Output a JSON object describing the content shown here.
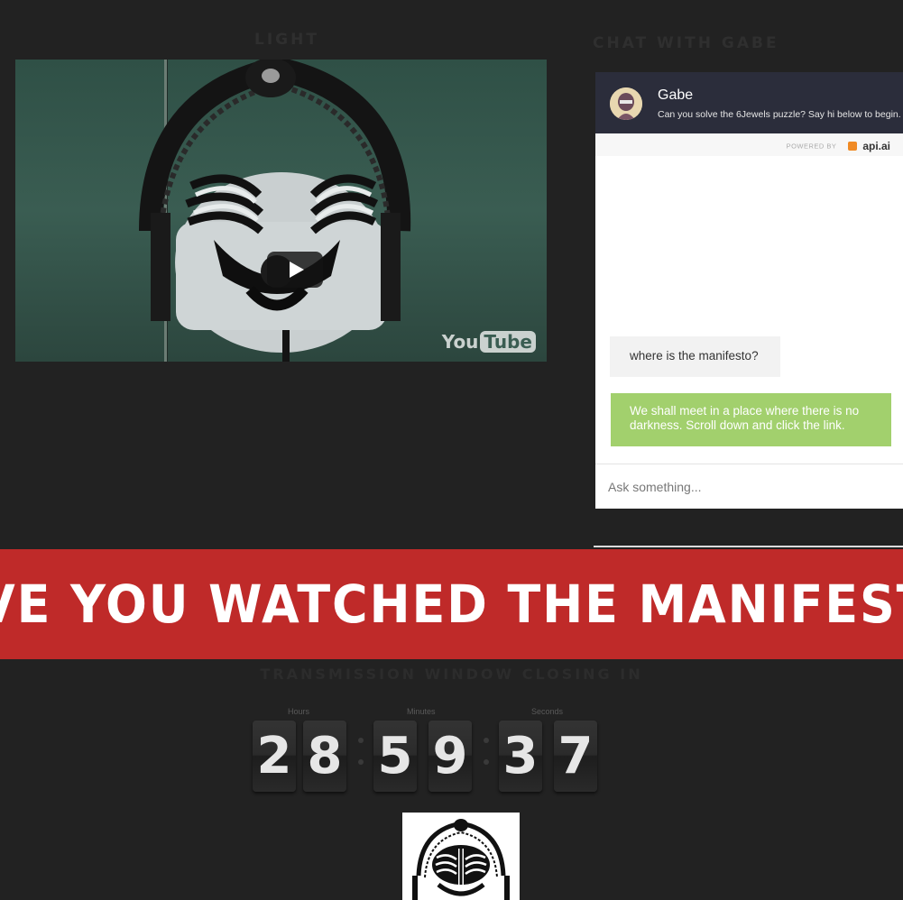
{
  "sections": {
    "light_title": "LIGHT",
    "chat_title": "CHAT WITH GABE"
  },
  "video": {
    "logo_you": "You",
    "logo_tube": "Tube"
  },
  "chat": {
    "agent_name": "Gabe",
    "agent_subtitle": "Can you solve the 6Jewels puzzle? Say hi below to begin.",
    "powered_by": "POWERED BY",
    "provider": "api.ai",
    "messages": [
      {
        "from": "user",
        "text": "where is the manifesto?"
      },
      {
        "from": "bot",
        "text": "We shall meet in a place where there is no darkness. Scroll down and click the link."
      }
    ],
    "input_placeholder": "Ask something...",
    "colors": {
      "header": "#2b2d3b",
      "bot_bubble": "#a2d06d",
      "user_bubble": "#f2f2f2"
    }
  },
  "banner": {
    "text": "HAVE YOU WATCHED THE MANIFESTO?",
    "color": "#bf2a29"
  },
  "countdown": {
    "title": "TRANSMISSION WINDOW CLOSING IN",
    "labels": {
      "hours": "Hours",
      "minutes": "Minutes",
      "seconds": "Seconds"
    },
    "digits": [
      "2",
      "8",
      "5",
      "9",
      "3",
      "7"
    ]
  }
}
